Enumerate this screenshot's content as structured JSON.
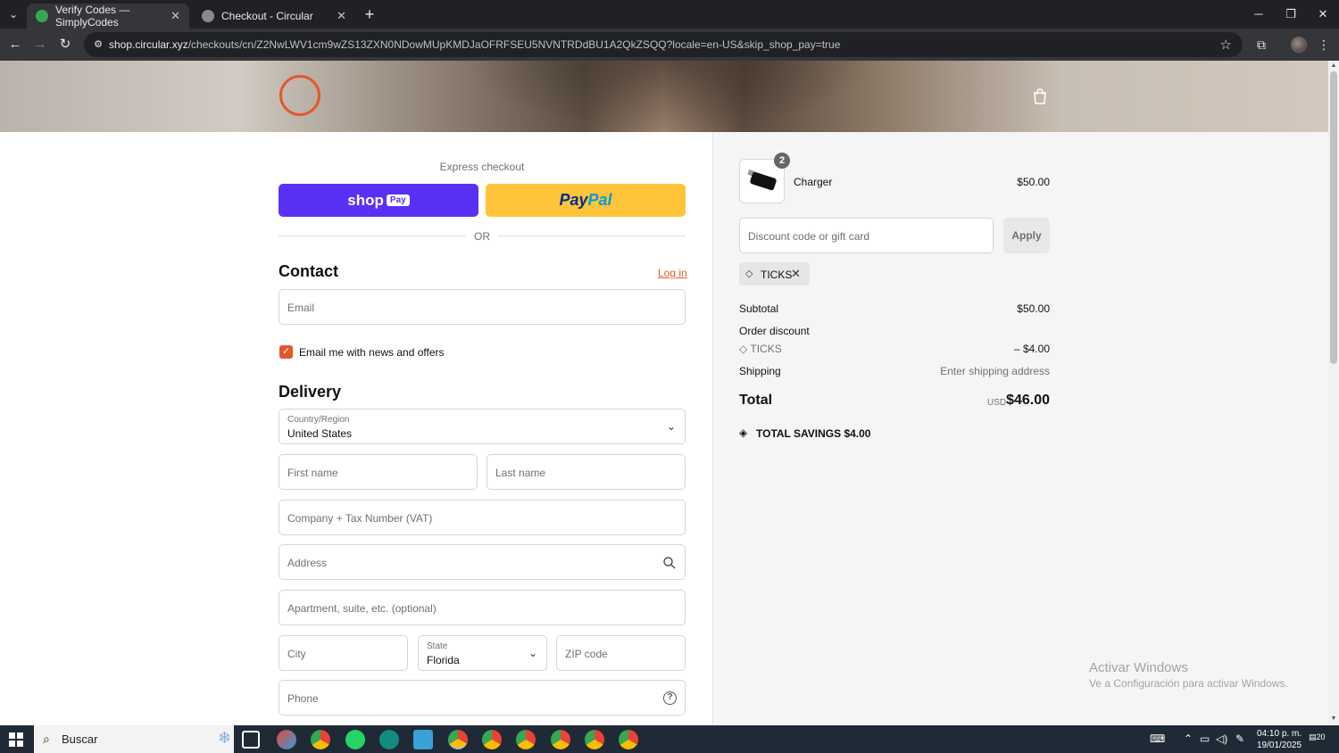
{
  "browser": {
    "tabs": [
      {
        "title": "Verify Codes — SimplyCodes",
        "active": true,
        "favicon_color": "#34a853"
      },
      {
        "title": "Checkout - Circular",
        "active": false,
        "favicon_color": "#8a8a8a"
      }
    ],
    "url_domain": "shop.circular.xyz",
    "url_path": "/checkouts/cn/Z2NwLWV1cm9wZS13ZXN0NDowMUpKMDJaOFRFSEU5NVNTRDdBU1A2QkZSQQ?locale=en-US&skip_shop_pay=true"
  },
  "checkout": {
    "express_label": "Express checkout",
    "shop_pay": {
      "brand": "shop",
      "chip": "Pay"
    },
    "paypal": {
      "part1": "Pay",
      "part2": "Pal"
    },
    "or_text": "OR",
    "contact": {
      "heading": "Contact",
      "login_link": "Log in",
      "email_placeholder": "Email",
      "newsletter_label": "Email me with news and offers",
      "newsletter_checked": true
    },
    "delivery": {
      "heading": "Delivery",
      "country_label": "Country/Region",
      "country_value": "United States",
      "first_name_placeholder": "First name",
      "last_name_placeholder": "Last name",
      "company_placeholder": "Company + Tax Number (VAT)",
      "address_placeholder": "Address",
      "apartment_placeholder": "Apartment, suite, etc. (optional)",
      "city_placeholder": "City",
      "state_label": "State",
      "state_value": "Florida",
      "zip_placeholder": "ZIP code",
      "phone_placeholder": "Phone"
    }
  },
  "summary": {
    "product": {
      "name": "Charger",
      "price": "$50.00",
      "quantity": "2"
    },
    "discount_placeholder": "Discount code or gift card",
    "apply_label": "Apply",
    "applied_code": "TICKS",
    "subtotal_label": "Subtotal",
    "subtotal_value": "$50.00",
    "order_discount_label": "Order discount",
    "discount_code": "TICKS",
    "discount_value": "– $4.00",
    "shipping_label": "Shipping",
    "shipping_value": "Enter shipping address",
    "total_label": "Total",
    "total_currency": "USD",
    "total_value": "$46.00",
    "savings_text": "TOTAL SAVINGS  $4.00"
  },
  "windows_activation": {
    "title": "Activar Windows",
    "subtitle": "Ve a Configuración para activar Windows."
  },
  "taskbar": {
    "search_placeholder": "Buscar",
    "clock_time": "04:10 p. m.",
    "clock_date": "19/01/2025",
    "notification_count": "20",
    "whatsapp_badge": "4"
  },
  "colors": {
    "accent": "#e4572e",
    "shop_pay": "#5a31f4",
    "paypal": "#ffc439"
  }
}
